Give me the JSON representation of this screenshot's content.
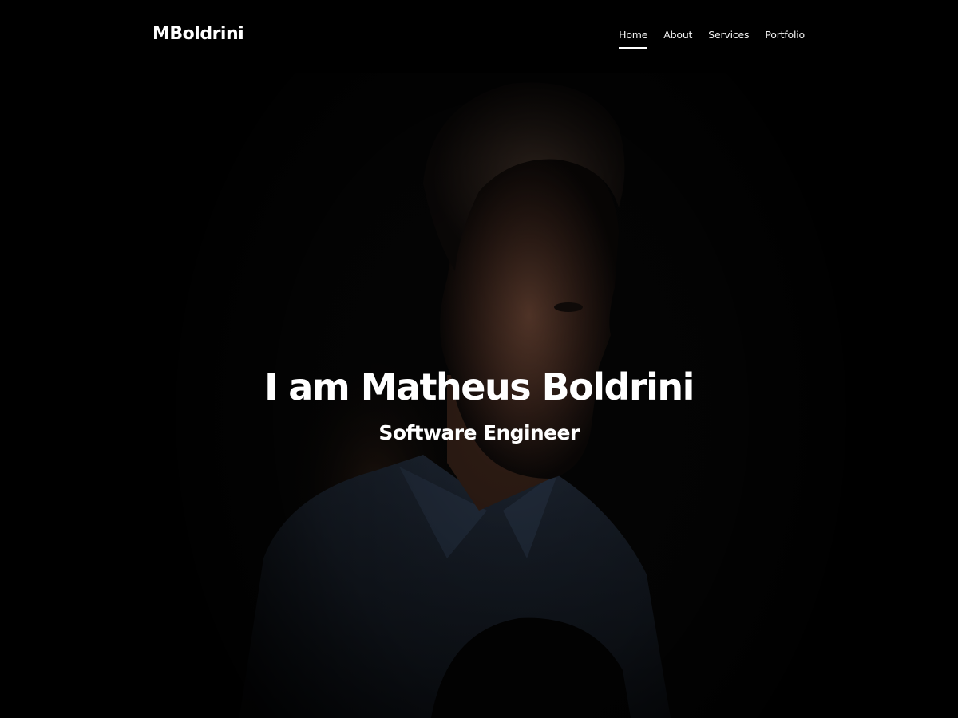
{
  "navbar": {
    "brand": "MBoldrini",
    "items": [
      {
        "label": "Home",
        "active": true
      },
      {
        "label": "About",
        "active": false
      },
      {
        "label": "Services",
        "active": false
      },
      {
        "label": "Portfolio",
        "active": false
      }
    ]
  },
  "hero": {
    "title": "I am Matheus Boldrini",
    "subtitle": "Software Engineer",
    "image": "portrait-photo"
  },
  "colors": {
    "background": "#000000",
    "text": "#ffffff",
    "navbar": "#000000"
  }
}
